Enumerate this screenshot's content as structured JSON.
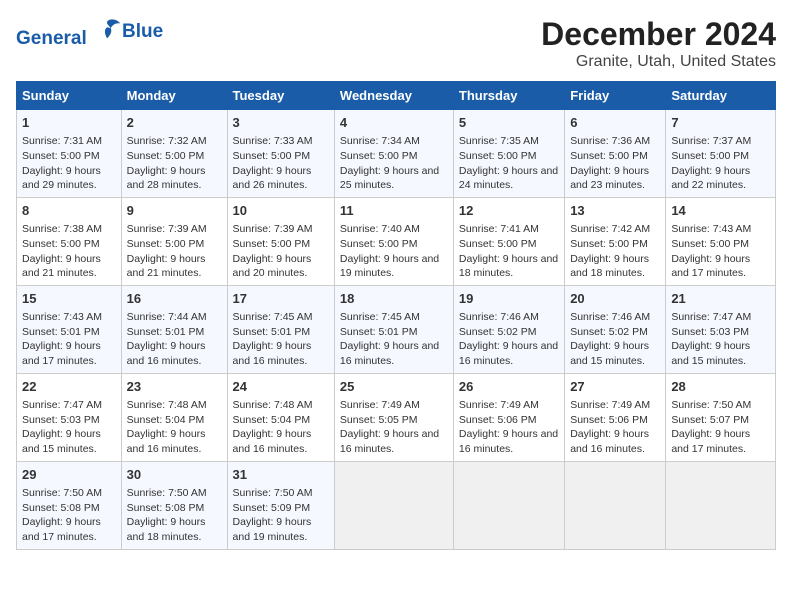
{
  "header": {
    "logo_line1": "General",
    "logo_line2": "Blue",
    "title": "December 2024",
    "subtitle": "Granite, Utah, United States"
  },
  "days_of_week": [
    "Sunday",
    "Monday",
    "Tuesday",
    "Wednesday",
    "Thursday",
    "Friday",
    "Saturday"
  ],
  "weeks": [
    [
      {
        "day": "1",
        "sunrise": "Sunrise: 7:31 AM",
        "sunset": "Sunset: 5:00 PM",
        "daylight": "Daylight: 9 hours and 29 minutes."
      },
      {
        "day": "2",
        "sunrise": "Sunrise: 7:32 AM",
        "sunset": "Sunset: 5:00 PM",
        "daylight": "Daylight: 9 hours and 28 minutes."
      },
      {
        "day": "3",
        "sunrise": "Sunrise: 7:33 AM",
        "sunset": "Sunset: 5:00 PM",
        "daylight": "Daylight: 9 hours and 26 minutes."
      },
      {
        "day": "4",
        "sunrise": "Sunrise: 7:34 AM",
        "sunset": "Sunset: 5:00 PM",
        "daylight": "Daylight: 9 hours and 25 minutes."
      },
      {
        "day": "5",
        "sunrise": "Sunrise: 7:35 AM",
        "sunset": "Sunset: 5:00 PM",
        "daylight": "Daylight: 9 hours and 24 minutes."
      },
      {
        "day": "6",
        "sunrise": "Sunrise: 7:36 AM",
        "sunset": "Sunset: 5:00 PM",
        "daylight": "Daylight: 9 hours and 23 minutes."
      },
      {
        "day": "7",
        "sunrise": "Sunrise: 7:37 AM",
        "sunset": "Sunset: 5:00 PM",
        "daylight": "Daylight: 9 hours and 22 minutes."
      }
    ],
    [
      {
        "day": "8",
        "sunrise": "Sunrise: 7:38 AM",
        "sunset": "Sunset: 5:00 PM",
        "daylight": "Daylight: 9 hours and 21 minutes."
      },
      {
        "day": "9",
        "sunrise": "Sunrise: 7:39 AM",
        "sunset": "Sunset: 5:00 PM",
        "daylight": "Daylight: 9 hours and 21 minutes."
      },
      {
        "day": "10",
        "sunrise": "Sunrise: 7:39 AM",
        "sunset": "Sunset: 5:00 PM",
        "daylight": "Daylight: 9 hours and 20 minutes."
      },
      {
        "day": "11",
        "sunrise": "Sunrise: 7:40 AM",
        "sunset": "Sunset: 5:00 PM",
        "daylight": "Daylight: 9 hours and 19 minutes."
      },
      {
        "day": "12",
        "sunrise": "Sunrise: 7:41 AM",
        "sunset": "Sunset: 5:00 PM",
        "daylight": "Daylight: 9 hours and 18 minutes."
      },
      {
        "day": "13",
        "sunrise": "Sunrise: 7:42 AM",
        "sunset": "Sunset: 5:00 PM",
        "daylight": "Daylight: 9 hours and 18 minutes."
      },
      {
        "day": "14",
        "sunrise": "Sunrise: 7:43 AM",
        "sunset": "Sunset: 5:00 PM",
        "daylight": "Daylight: 9 hours and 17 minutes."
      }
    ],
    [
      {
        "day": "15",
        "sunrise": "Sunrise: 7:43 AM",
        "sunset": "Sunset: 5:01 PM",
        "daylight": "Daylight: 9 hours and 17 minutes."
      },
      {
        "day": "16",
        "sunrise": "Sunrise: 7:44 AM",
        "sunset": "Sunset: 5:01 PM",
        "daylight": "Daylight: 9 hours and 16 minutes."
      },
      {
        "day": "17",
        "sunrise": "Sunrise: 7:45 AM",
        "sunset": "Sunset: 5:01 PM",
        "daylight": "Daylight: 9 hours and 16 minutes."
      },
      {
        "day": "18",
        "sunrise": "Sunrise: 7:45 AM",
        "sunset": "Sunset: 5:01 PM",
        "daylight": "Daylight: 9 hours and 16 minutes."
      },
      {
        "day": "19",
        "sunrise": "Sunrise: 7:46 AM",
        "sunset": "Sunset: 5:02 PM",
        "daylight": "Daylight: 9 hours and 16 minutes."
      },
      {
        "day": "20",
        "sunrise": "Sunrise: 7:46 AM",
        "sunset": "Sunset: 5:02 PM",
        "daylight": "Daylight: 9 hours and 15 minutes."
      },
      {
        "day": "21",
        "sunrise": "Sunrise: 7:47 AM",
        "sunset": "Sunset: 5:03 PM",
        "daylight": "Daylight: 9 hours and 15 minutes."
      }
    ],
    [
      {
        "day": "22",
        "sunrise": "Sunrise: 7:47 AM",
        "sunset": "Sunset: 5:03 PM",
        "daylight": "Daylight: 9 hours and 15 minutes."
      },
      {
        "day": "23",
        "sunrise": "Sunrise: 7:48 AM",
        "sunset": "Sunset: 5:04 PM",
        "daylight": "Daylight: 9 hours and 16 minutes."
      },
      {
        "day": "24",
        "sunrise": "Sunrise: 7:48 AM",
        "sunset": "Sunset: 5:04 PM",
        "daylight": "Daylight: 9 hours and 16 minutes."
      },
      {
        "day": "25",
        "sunrise": "Sunrise: 7:49 AM",
        "sunset": "Sunset: 5:05 PM",
        "daylight": "Daylight: 9 hours and 16 minutes."
      },
      {
        "day": "26",
        "sunrise": "Sunrise: 7:49 AM",
        "sunset": "Sunset: 5:06 PM",
        "daylight": "Daylight: 9 hours and 16 minutes."
      },
      {
        "day": "27",
        "sunrise": "Sunrise: 7:49 AM",
        "sunset": "Sunset: 5:06 PM",
        "daylight": "Daylight: 9 hours and 16 minutes."
      },
      {
        "day": "28",
        "sunrise": "Sunrise: 7:50 AM",
        "sunset": "Sunset: 5:07 PM",
        "daylight": "Daylight: 9 hours and 17 minutes."
      }
    ],
    [
      {
        "day": "29",
        "sunrise": "Sunrise: 7:50 AM",
        "sunset": "Sunset: 5:08 PM",
        "daylight": "Daylight: 9 hours and 17 minutes."
      },
      {
        "day": "30",
        "sunrise": "Sunrise: 7:50 AM",
        "sunset": "Sunset: 5:08 PM",
        "daylight": "Daylight: 9 hours and 18 minutes."
      },
      {
        "day": "31",
        "sunrise": "Sunrise: 7:50 AM",
        "sunset": "Sunset: 5:09 PM",
        "daylight": "Daylight: 9 hours and 19 minutes."
      },
      null,
      null,
      null,
      null
    ]
  ]
}
